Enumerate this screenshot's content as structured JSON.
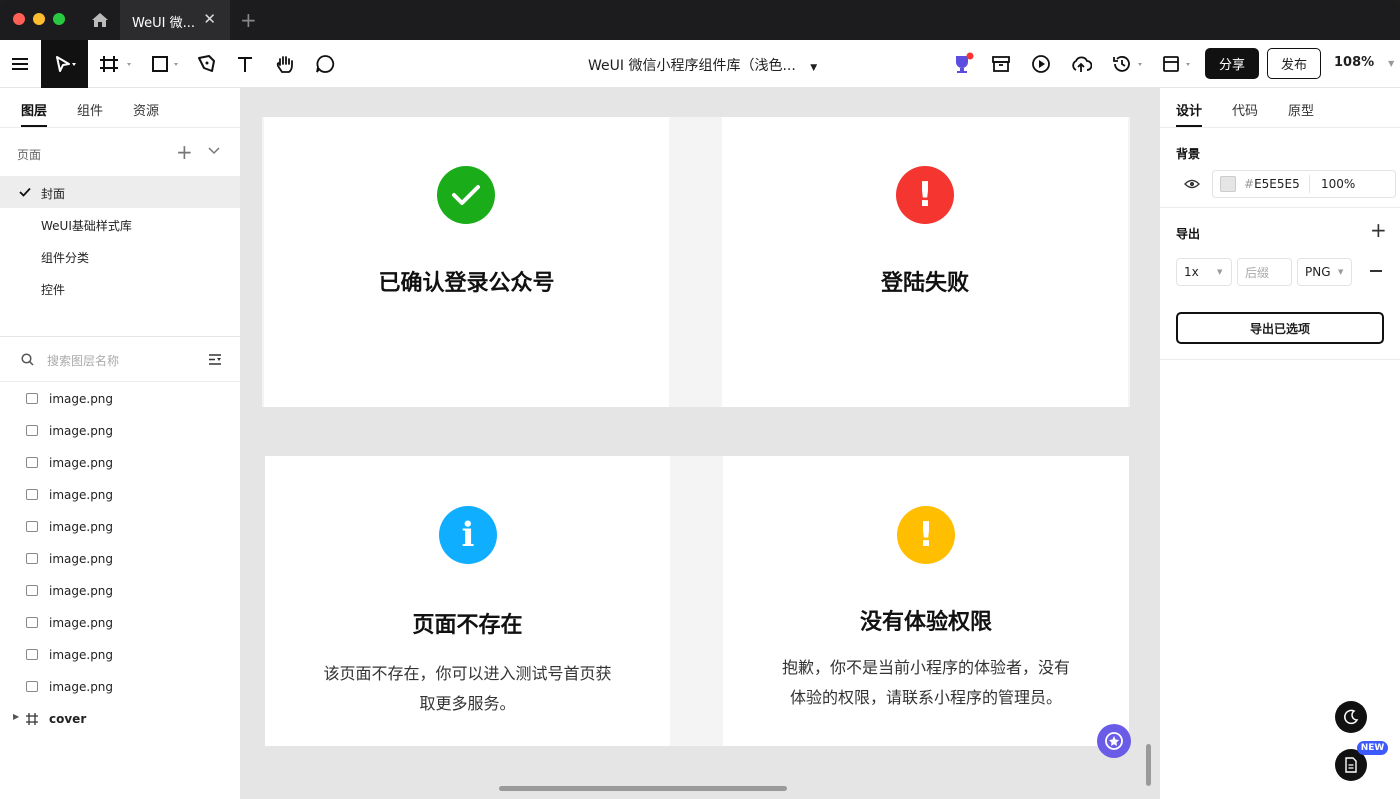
{
  "window": {
    "tab_title": "WeUI 微...",
    "colors": {
      "close": "#ff5f57",
      "minimize": "#febc2e",
      "maximize": "#28c840"
    }
  },
  "toolbar": {
    "doc_title": "WeUI 微信小程序组件库（浅色...",
    "share_label": "分享",
    "publish_label": "发布",
    "zoom": "108%"
  },
  "left_panel": {
    "tabs": [
      "图层",
      "组件",
      "资源"
    ],
    "pages_header": "页面",
    "pages": [
      "封面",
      "WeUI基础样式库",
      "组件分类",
      "控件"
    ],
    "search_placeholder": "搜索图层名称",
    "layers": [
      "image.png",
      "image.png",
      "image.png",
      "image.png",
      "image.png",
      "image.png",
      "image.png",
      "image.png",
      "image.png",
      "image.png"
    ],
    "frame_layer": "cover"
  },
  "canvas": {
    "cards": [
      {
        "title": "已确认登录公众号",
        "desc": "",
        "icon": "check-icon",
        "glyph": "✓",
        "color": "#1aad19"
      },
      {
        "title": "登陆失败",
        "desc": "",
        "icon": "error-icon",
        "glyph": "!",
        "color": "#f43530"
      },
      {
        "title": "页面不存在",
        "desc_line1": "该页面不存在，你可以进入测试号首页获",
        "desc_line2": "取更多服务。",
        "icon": "info-icon",
        "glyph": "i",
        "color": "#10aeff"
      },
      {
        "title": "没有体验权限",
        "desc_line1": "抱歉，你不是当前小程序的体验者，没有",
        "desc_line2": "体验的权限，请联系小程序的管理员。",
        "icon": "warning-icon",
        "glyph": "!",
        "color": "#ffbe00"
      }
    ]
  },
  "right_panel": {
    "tabs": [
      "设计",
      "代码",
      "原型"
    ],
    "background_title": "背景",
    "bg_hash": "#",
    "bg_hex": "E5E5E5",
    "bg_opacity": "100%",
    "export_title": "导出",
    "export_scale": "1x",
    "export_suffix_placeholder": "后缀",
    "export_format": "PNG",
    "export_button": "导出已选项",
    "new_badge": "NEW"
  }
}
